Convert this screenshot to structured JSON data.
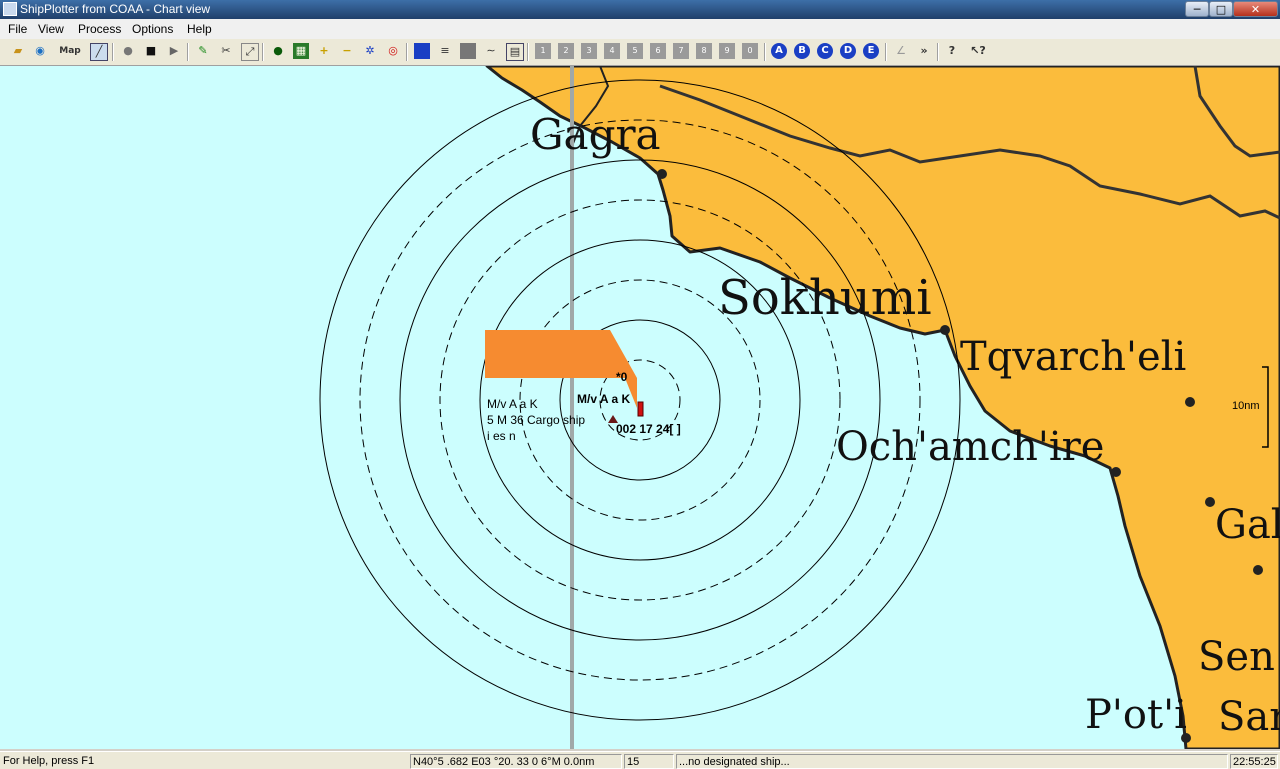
{
  "window": {
    "title": "ShipPlotter from COAA - Chart view",
    "min_glyph": "─",
    "max_glyph": "□",
    "close_glyph": "✕"
  },
  "menu": [
    "File",
    "View",
    "Process",
    "Options",
    "Help"
  ],
  "toolbar": {
    "map_label": "Map",
    "circle_buttons": [
      "A",
      "B",
      "C",
      "D",
      "E"
    ]
  },
  "map": {
    "colors": {
      "sea": "#ccfefe",
      "land": "#fbbc3c",
      "popup": "#f68b30"
    },
    "places": [
      "Gagra",
      "Sokhumi",
      "Tqvarch'eli",
      "Och'amch'ire",
      "Gal",
      "Sen",
      "Sar",
      "P'ot'i"
    ],
    "scale_label": "10nm"
  },
  "ship": {
    "popup_lines": [
      "M/v A    a K",
      "5 M  36  Cargo ship",
      "  i es  n"
    ],
    "heading_mark": "*0",
    "name_label": "M/v A    a K",
    "info_label": "002  17  24[  ]"
  },
  "status": {
    "help": "For Help, press F1",
    "position": "N40°5  .682 E03  °20.  33 0  6°M 0.0nm",
    "count": "15",
    "designated": "...no designated ship...",
    "time": "22:55:25"
  }
}
